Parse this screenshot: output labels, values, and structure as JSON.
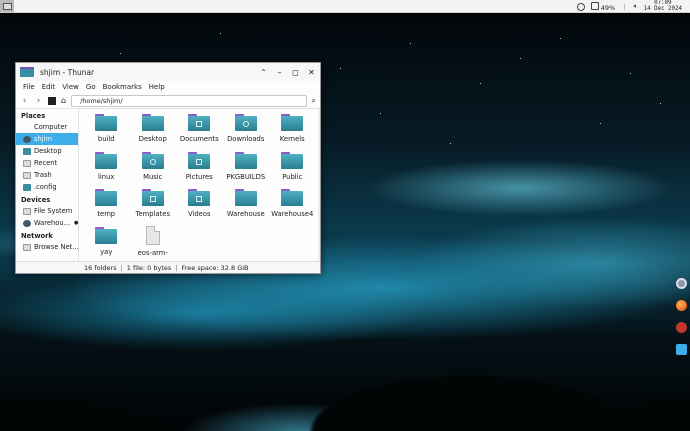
{
  "panel": {
    "battery": "49%",
    "clock_time": "07:09",
    "clock_date": "14 Dec 2024"
  },
  "window": {
    "title": "shjim - Thunar",
    "menu": [
      "File",
      "Edit",
      "View",
      "Go",
      "Bookmarks",
      "Help"
    ],
    "path": "/home/shjim/",
    "sidebar": {
      "places_label": "Places",
      "places": [
        "Computer",
        "shjim",
        "Desktop",
        "Recent",
        "Trash",
        ".config"
      ],
      "devices_label": "Devices",
      "devices": [
        "File System",
        "Warehou..."
      ],
      "network_label": "Network",
      "network": [
        "Browse Net..."
      ]
    },
    "files": [
      "build",
      "Desktop",
      "Documents",
      "Downloads",
      "Kernels",
      "linux",
      "Music",
      "Pictures",
      "PKGBUILDS",
      "Public",
      "temp",
      "Templates",
      "Videos",
      "Warehouse",
      "Warehouse4",
      "yay",
      "eos-arm-"
    ],
    "status": {
      "folders": "16 folders",
      "file": "1 file: 0 bytes",
      "free": "Free space: 32.8 GiB"
    }
  },
  "colors": {
    "folder_body": "#3b8ea0",
    "folder_tab": "#8b5cc7",
    "selection": "#3daee9"
  }
}
